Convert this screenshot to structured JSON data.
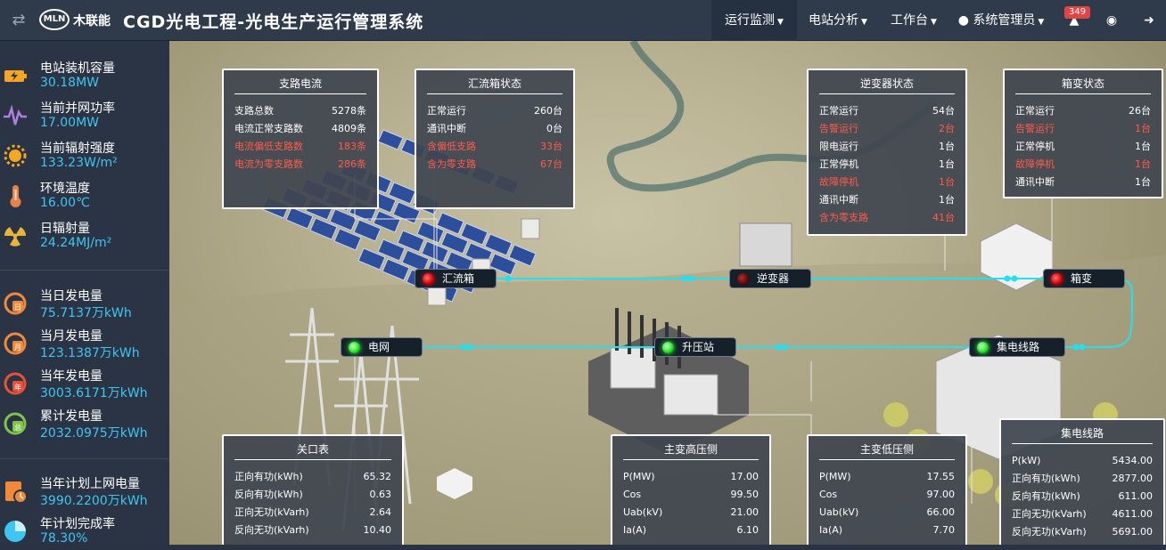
{
  "header": {
    "logo_badge": "MLN",
    "logo_text": "木联能",
    "title": "CGD光电工程-光电生产运行管理系统",
    "nav": [
      "运行监测",
      "电站分析",
      "工作台",
      "系统管理员"
    ],
    "notification_count": "349"
  },
  "sidebar": {
    "group1": [
      {
        "icon": "battery-icon",
        "label": "电站装机容量",
        "value": "30.18MW"
      },
      {
        "icon": "power-wave-icon",
        "label": "当前并网功率",
        "value": "17.00MW"
      },
      {
        "icon": "sun-icon",
        "label": "当前辐射强度",
        "value": "133.23W/m²"
      },
      {
        "icon": "thermometer-icon",
        "label": "环境温度",
        "value": "16.00℃"
      },
      {
        "icon": "radiation-icon",
        "label": "日辐射量",
        "value": "24.24MJ/m²"
      }
    ],
    "group2": [
      {
        "icon": "daily-energy-icon",
        "label": "当日发电量",
        "value": "75.7137万kWh"
      },
      {
        "icon": "monthly-energy-icon",
        "label": "当月发电量",
        "value": "123.1387万kWh"
      },
      {
        "icon": "yearly-energy-icon",
        "label": "当年发电量",
        "value": "3003.6171万kWh"
      },
      {
        "icon": "total-energy-icon",
        "label": "累计发电量",
        "value": "2032.0975万kWh"
      }
    ],
    "group3": [
      {
        "icon": "plan-icon",
        "label": "当年计划上网电量",
        "value": "3990.2200万kWh"
      },
      {
        "icon": "pie-chart-icon",
        "label": "年计划完成率",
        "value": "78.30%"
      }
    ]
  },
  "panels": {
    "branch_current": {
      "title": "支路电流",
      "rows": [
        {
          "k": "支路总数",
          "v": "5278条",
          "alert": false
        },
        {
          "k": "电流正常支路数",
          "v": "4809条",
          "alert": false
        },
        {
          "k": "电流偏低支路数",
          "v": "183条",
          "alert": true
        },
        {
          "k": "电流为零支路数",
          "v": "286条",
          "alert": true
        }
      ]
    },
    "combiner_status": {
      "title": "汇流箱状态",
      "rows": [
        {
          "k": "正常运行",
          "v": "260台",
          "alert": false
        },
        {
          "k": "通讯中断",
          "v": "0台",
          "alert": false
        },
        {
          "k": "含偏低支路",
          "v": "33台",
          "alert": true
        },
        {
          "k": "含为零支路",
          "v": "67台",
          "alert": true
        }
      ]
    },
    "inverter_status": {
      "title": "逆变器状态",
      "rows": [
        {
          "k": "正常运行",
          "v": "54台",
          "alert": false
        },
        {
          "k": "告警运行",
          "v": "2台",
          "alert": true
        },
        {
          "k": "限电运行",
          "v": "1台",
          "alert": false
        },
        {
          "k": "正常停机",
          "v": "1台",
          "alert": false
        },
        {
          "k": "故障停机",
          "v": "1台",
          "alert": true
        },
        {
          "k": "通讯中断",
          "v": "1台",
          "alert": false
        },
        {
          "k": "含为零支路",
          "v": "41台",
          "alert": true
        }
      ]
    },
    "box_transformer_status": {
      "title": "箱变状态",
      "rows": [
        {
          "k": "正常运行",
          "v": "26台",
          "alert": false
        },
        {
          "k": "告警运行",
          "v": "1台",
          "alert": true
        },
        {
          "k": "正常停机",
          "v": "1台",
          "alert": false
        },
        {
          "k": "故障停机",
          "v": "1台",
          "alert": true
        },
        {
          "k": "通讯中断",
          "v": "1台",
          "alert": false
        }
      ]
    },
    "gateway_meter": {
      "title": "关口表",
      "rows": [
        {
          "k": "正向有功(kWh)",
          "v": "65.32",
          "alert": false
        },
        {
          "k": "反向有功(kWh)",
          "v": "0.63",
          "alert": false
        },
        {
          "k": "正向无功(kVarh)",
          "v": "2.64",
          "alert": false
        },
        {
          "k": "反向无功(kVarh)",
          "v": "10.40",
          "alert": false
        }
      ]
    },
    "main_transformer_high": {
      "title": "主变高压侧",
      "rows": [
        {
          "k": "P(MW)",
          "v": "17.00",
          "alert": false
        },
        {
          "k": "Cos",
          "v": "99.50",
          "alert": false
        },
        {
          "k": "Uab(kV)",
          "v": "21.00",
          "alert": false
        },
        {
          "k": "Ia(A)",
          "v": "6.10",
          "alert": false
        }
      ]
    },
    "main_transformer_low": {
      "title": "主变低压侧",
      "rows": [
        {
          "k": "P(MW)",
          "v": "17.55",
          "alert": false
        },
        {
          "k": "Cos",
          "v": "97.00",
          "alert": false
        },
        {
          "k": "Uab(kV)",
          "v": "66.00",
          "alert": false
        },
        {
          "k": "Ia(A)",
          "v": "7.70",
          "alert": false
        }
      ]
    },
    "collector_line": {
      "title": "集电线路",
      "rows": [
        {
          "k": "P(kW)",
          "v": "5434.00",
          "alert": false
        },
        {
          "k": "正向有功(kWh)",
          "v": "2877.00",
          "alert": false
        },
        {
          "k": "反向有功(kWh)",
          "v": "611.00",
          "alert": false
        },
        {
          "k": "正向无功(kVarh)",
          "v": "4611.00",
          "alert": false
        },
        {
          "k": "反向无功(kVarh)",
          "v": "5691.00",
          "alert": false
        }
      ]
    }
  },
  "nodes": {
    "combiner": "汇流箱",
    "inverter": "逆变器",
    "box_transformer": "箱变",
    "grid": "电网",
    "booster": "升压站",
    "collector": "集电线路"
  },
  "colors": {
    "accent": "#3ec6f2",
    "alert": "#ff5b4a",
    "flow_line": "#23e0f0"
  }
}
